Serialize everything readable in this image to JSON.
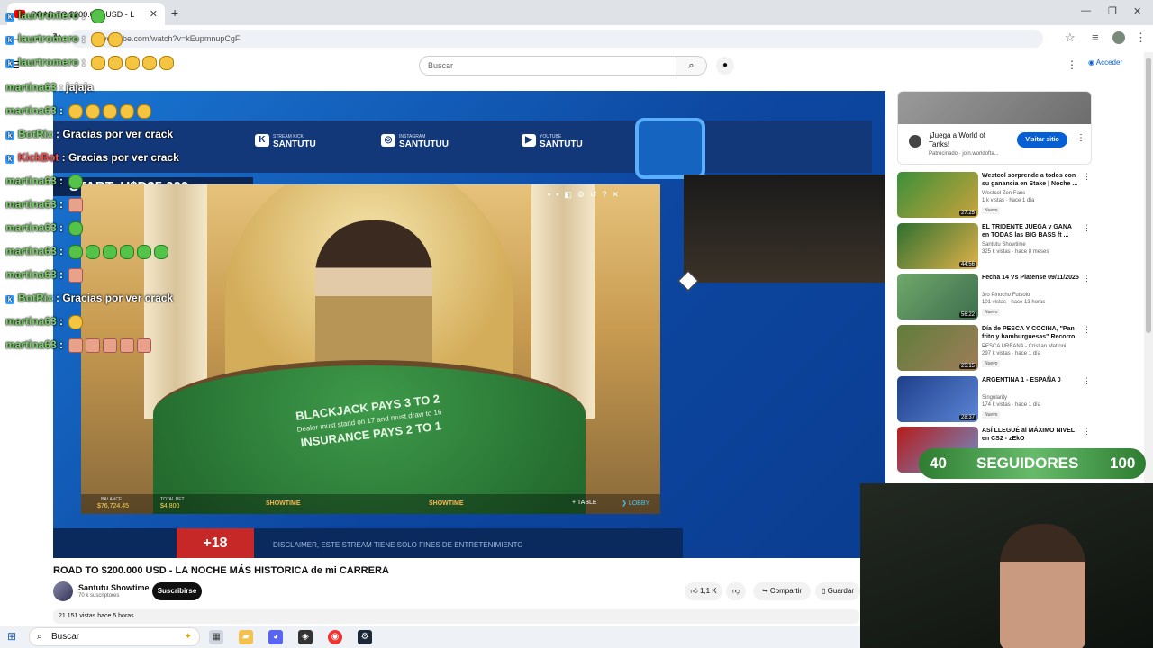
{
  "browser": {
    "tab_title": "ROAD TO $200.000 USD - L",
    "url": "youtube.com/watch?v=kEupmnupCgF",
    "new_tab": "+"
  },
  "youtube": {
    "logo": "YouTube",
    "search_placeholder": "Buscar",
    "signin": "Acceder"
  },
  "stream": {
    "socials": [
      {
        "label": "STREAM KICK",
        "name": "SANTUTU"
      },
      {
        "label": "INSTAGRAM",
        "name": "SANTUTUU"
      },
      {
        "label": "YOUTUBE",
        "name": "SANTUTU"
      }
    ],
    "start_text": "START: U$D35.000",
    "age": "+18",
    "disclaimer": "DISCLAIMER, ESTE STREAM TIENE SOLO FINES DE ENTRETENIMIENTO",
    "game": {
      "balance_label": "BALANCE",
      "balance_value": "$76,724.45",
      "totalbet_label": "TOTAL BET",
      "totalbet_value": "$4,800",
      "showtime1": "SHOWTIME",
      "showtime2": "SHOWTIME",
      "table_btn": "TABLE",
      "lobby_btn": "LOBBY",
      "table_line1": "BLACKJACK PAYS 3 TO 2",
      "table_line2": "Dealer must stand on 17 and must draw to 16",
      "table_line3": "INSURANCE PAYS 2 TO 1"
    }
  },
  "chat": [
    {
      "user": "laurtromero",
      "text": ""
    },
    {
      "user": "laurtromero",
      "text": ""
    },
    {
      "user": "laurtromero",
      "text": ""
    },
    {
      "user": "martina63",
      "text": "jajaja"
    },
    {
      "user": "martina63",
      "text": ""
    },
    {
      "user": "BotRix",
      "text": "Gracias por ver crack"
    },
    {
      "user": "KickBot",
      "text": "Gracias por ver crack"
    },
    {
      "user": "martina63",
      "text": ""
    },
    {
      "user": "martina63",
      "text": ""
    },
    {
      "user": "martina63",
      "text": ""
    },
    {
      "user": "martina63",
      "text": ""
    },
    {
      "user": "martina63",
      "text": ""
    },
    {
      "user": "BotRix",
      "text": "Gracias por ver crack"
    },
    {
      "user": "martina63",
      "text": ""
    },
    {
      "user": "martina63",
      "text": ""
    }
  ],
  "video": {
    "title": "ROAD TO $200.000 USD - LA NOCHE MÁS HISTORICA de mi CARRERA",
    "channel": "Santutu Showtime",
    "subs": "70 k suscriptores",
    "subscribe": "Suscribirse",
    "likes": "1,1 K",
    "share": "Compartir",
    "save": "Guardar",
    "views": "21.151 vistas  hace 5 horas"
  },
  "ad": {
    "title": "¡Juega a World of Tanks!",
    "sponsor": "Patrocinado · join.worldofta...",
    "cta": "Visitar sitio"
  },
  "recommendations": [
    {
      "title": "Westcol sorprende a todos con su ganancia en Stake | Noche ...",
      "channel": "Westcol Zen Fans",
      "meta": "1 k vistas · hace 1 día",
      "duration": "27:25",
      "badge": "Nuevo"
    },
    {
      "title": "EL TRIDENTE JUEGA y GANA en TODAS las BIG BASS ft ...",
      "channel": "Santutu Showtime",
      "meta": "325 k vistas · hace 8 meses",
      "duration": "44:56",
      "badge": ""
    },
    {
      "title": "Fecha 14 Vs Platense 09/11/2025",
      "channel": "3ro Pinocho Futsolo",
      "meta": "101 vistas · hace 13 horas",
      "duration": "56:22",
      "badge": "Nuevo"
    },
    {
      "title": "Día de PESCA Y COCINA, \"Pan frito y hamburguesas\" Recorro ...",
      "channel": "PESCA URBANA - Cristian Mattoni",
      "meta": "297 k vistas · hace 1 día",
      "duration": "25:15",
      "badge": "Nuevo"
    },
    {
      "title": "ARGENTINA 1 - ESPAÑA 0",
      "channel": "Singularity",
      "meta": "174 k vistas · hace 1 día",
      "duration": "28:37",
      "badge": "Nuevo"
    },
    {
      "title": "ASÍ LLEGUÉ al MÁXIMO NIVEL en CS2 - zEkO",
      "channel": "",
      "meta": "",
      "duration": "",
      "badge": ""
    }
  ],
  "overlay_goal": {
    "left": "40",
    "label": "SEGUIDORES",
    "right": "100"
  },
  "taskbar": {
    "search": "Buscar"
  }
}
